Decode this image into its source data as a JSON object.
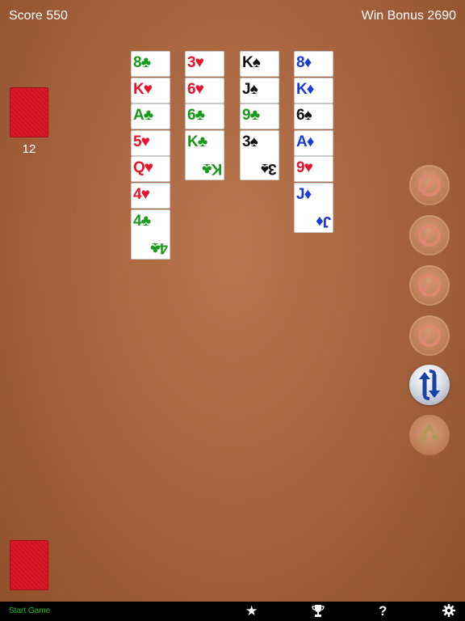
{
  "hud": {
    "score": "Score 550",
    "bonus": "Win Bonus 2690"
  },
  "stock": {
    "count": "12"
  },
  "columns": [
    {
      "cards": [
        {
          "rank": "8",
          "suit": "♣",
          "color": "clubs"
        },
        {
          "rank": "K",
          "suit": "♥",
          "color": "hearts"
        },
        {
          "rank": "A",
          "suit": "♣",
          "color": "clubs"
        },
        {
          "rank": "5",
          "suit": "♥",
          "color": "hearts"
        },
        {
          "rank": "Q",
          "suit": "♥",
          "color": "hearts"
        },
        {
          "rank": "4",
          "suit": "♥",
          "color": "hearts"
        },
        {
          "rank": "4",
          "suit": "♣",
          "color": "clubs"
        }
      ]
    },
    {
      "cards": [
        {
          "rank": "3",
          "suit": "♥",
          "color": "hearts"
        },
        {
          "rank": "6",
          "suit": "♥",
          "color": "hearts"
        },
        {
          "rank": "6",
          "suit": "♣",
          "color": "clubs"
        },
        {
          "rank": "K",
          "suit": "♣",
          "color": "clubs"
        }
      ]
    },
    {
      "cards": [
        {
          "rank": "K",
          "suit": "♠",
          "color": "spades"
        },
        {
          "rank": "J",
          "suit": "♠",
          "color": "spades"
        },
        {
          "rank": "9",
          "suit": "♣",
          "color": "clubs"
        },
        {
          "rank": "3",
          "suit": "♠",
          "color": "spades"
        }
      ]
    },
    {
      "cards": [
        {
          "rank": "8",
          "suit": "♦",
          "color": "diamonds"
        },
        {
          "rank": "K",
          "suit": "♦",
          "color": "diamonds"
        },
        {
          "rank": "6",
          "suit": "♠",
          "color": "spades"
        },
        {
          "rank": "A",
          "suit": "♦",
          "color": "diamonds"
        },
        {
          "rank": "9",
          "suit": "♥",
          "color": "hearts"
        },
        {
          "rank": "J",
          "suit": "♦",
          "color": "diamonds"
        }
      ]
    }
  ],
  "side_buttons": [
    "no-entry-icon",
    "no-entry-icon",
    "no-entry-icon",
    "no-entry-icon",
    "swap-arrows-icon",
    "recycle-icon"
  ],
  "bottom_bar": {
    "start_label": "Start Game",
    "help_label": "?"
  },
  "colors": {
    "clubs": "#1a9a1a",
    "hearts": "#e8132a",
    "spades": "#111111",
    "diamonds": "#1a3bd6",
    "start_label": "#19c419"
  }
}
